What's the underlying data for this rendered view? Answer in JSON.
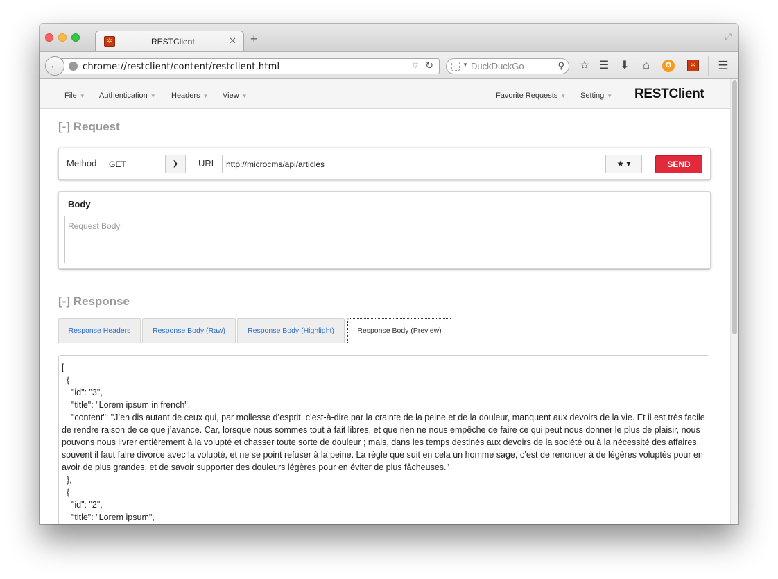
{
  "browser": {
    "tab_title": "RESTClient",
    "url": "chrome://restclient/content/restclient.html",
    "search_placeholder": "DuckDuckGo"
  },
  "app": {
    "brand": "RESTClient",
    "menu_left": [
      "File",
      "Authentication",
      "Headers",
      "View"
    ],
    "menu_right": [
      "Favorite Requests",
      "Setting"
    ]
  },
  "request": {
    "section_title": "[-] Request",
    "method_label": "Method",
    "method_value": "GET",
    "url_label": "URL",
    "url_value": "http://microcms/api/articles",
    "send_label": "SEND",
    "body_label": "Body",
    "body_placeholder": "Request Body"
  },
  "response": {
    "section_title": "[-] Response",
    "tabs": [
      "Response Headers",
      "Response Body (Raw)",
      "Response Body (Highlight)",
      "Response Body (Preview)"
    ],
    "active_tab": "Response Body (Preview)",
    "body": "[\n  {\n    \"id\": \"3\",\n    \"title\": \"Lorem ipsum in french\",\n    \"content\": \"J’en dis autant de ceux qui, par mollesse d’esprit, c’est-à-dire par la crainte de la peine et de la douleur, manquent aux devoirs de la vie. Et il est très facile de rendre raison de ce que j’avance. Car, lorsque nous sommes tout à fait libres, et que rien ne nous empêche de faire ce qui peut nous donner le plus de plaisir, nous pouvons nous livrer entièrement à la volupté et chasser toute sorte de douleur ; mais, dans les temps destinés aux devoirs de la société ou à la nécessité des affaires, souvent il faut faire divorce avec la volupté, et ne se point refuser à la peine. La règle que suit en cela un homme sage, c’est de renoncer à de légères voluptés pour en avoir de plus grandes, et de savoir supporter des douleurs légères pour en éviter de plus fâcheuses.\"\n  },\n  {\n    \"id\": \"2\",\n    \"title\": \"Lorem ipsum\","
  }
}
